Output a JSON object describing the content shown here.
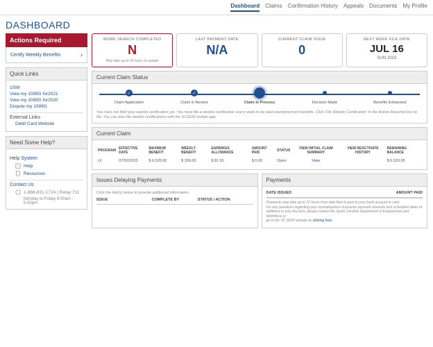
{
  "nav": {
    "items": [
      "Dashboard",
      "Claims",
      "Confirmation History",
      "Appeals",
      "Documents",
      "My Profile"
    ],
    "active": 0
  },
  "page_title": "DASHBOARD",
  "actions": {
    "header": "Actions Required",
    "items": [
      "Certify Weekly Benefits"
    ]
  },
  "quicklinks": {
    "header": "Quick Links",
    "links": [
      "1099",
      "View my 1099G for2021",
      "View my 1099G for2020",
      "Dispute my 1099G"
    ],
    "external_header": "External Links",
    "external_links": [
      "Debit Card Website"
    ]
  },
  "help": {
    "header": "Need Some Help?",
    "system_header": "Help System",
    "items": [
      "Help",
      "Resources"
    ],
    "contact_header": "Contact Us",
    "phone": "1-866-831-1724 | Relay 711",
    "hours": "Monday to Friday 8:00am - 5:00pm"
  },
  "stats": [
    {
      "label": "WORK SEARCH COMPLETED",
      "value": "N",
      "sub": "May take up to 24 hours to update",
      "cls": "red"
    },
    {
      "label": "LAST PAYMENT DATE",
      "value": "N/A",
      "cls": "blue"
    },
    {
      "label": "CURRENT CLAIM ISSUE",
      "value": "0",
      "cls": "blue"
    },
    {
      "label": "NEXT WEEK FILE DATE",
      "value": "JUL 16",
      "sub2": "SUN 2023",
      "cls": "black"
    }
  ],
  "claim_status": {
    "header": "Current Claim Status",
    "steps": [
      "Claim Application",
      "Claim in Review",
      "Claim In Process",
      "Decision Made",
      "Benefits Exhausted"
    ],
    "note": "You have not filed your weekly certification yet. You must file a weekly certification every week to be paid unemployment benefits. Click 'File Weekly Certification' in the Action Required box to file. You can also file weekly certifications with the SCDEW mobile app."
  },
  "current_claim": {
    "header": "Current Claim",
    "cols": [
      "PROGRAM",
      "EFFECTIVE DATE",
      "MAXIMUM BENEFIT",
      "WEEKLY BENEFIT",
      "EARNINGS ALLOWANCE",
      "AMOUNT PAID",
      "STATUS",
      "VIEW INITIAL CLAIM SUMMARY",
      "VIEW REACTIVATE HISTORY",
      "REMAINING BALANCE"
    ],
    "row": [
      "UI",
      "07/02/2023",
      "$ 6,520.00",
      "$ 326.00",
      "$ 81.50",
      "$ 0.00",
      "Open",
      "View",
      "",
      "$ 6,520.00"
    ]
  },
  "issues": {
    "header": "Issues Delaying Payments",
    "note": "Click the link(s) below to provide additional information.",
    "cols": [
      "ISSUE",
      "COMPLETE BY",
      "STATUS / ACTION"
    ]
  },
  "payments": {
    "header": "Payments",
    "cols": [
      "DATE ISSUED",
      "AMOUNT PAID"
    ],
    "note1": "Payments may take up to 72 hours from date filed to post to your bank account or card.",
    "note2": "For any questions regarding your unemployment insurance payment amounts and scheduled dates of additions to your Account, please contact the South Carolina Department of Employment and Workforce or",
    "note3": "go to the SC DEW website by ",
    "link": "clicking here"
  }
}
